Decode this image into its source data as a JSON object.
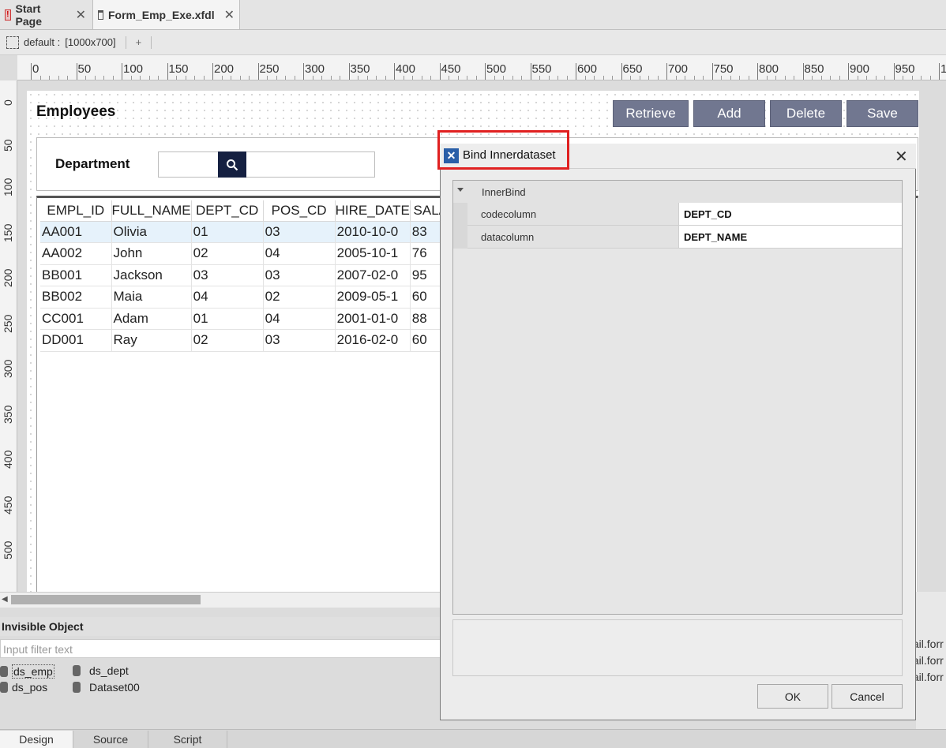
{
  "tabs": [
    {
      "label": "Start Page",
      "close": "✕"
    },
    {
      "label": "Form_Emp_Exe.xfdl",
      "close": "✕"
    }
  ],
  "toolbar": {
    "layout_label": "default :",
    "layout_size": "[1000x700]",
    "add": "+"
  },
  "ruler": {
    "h": [
      "0",
      "50",
      "100",
      "150",
      "200",
      "250",
      "300",
      "350",
      "400",
      "450",
      "500",
      "550",
      "600",
      "650",
      "700",
      "750",
      "800",
      "850",
      "900",
      "950",
      "1"
    ],
    "v": [
      "0",
      "50",
      "100",
      "150",
      "200",
      "250",
      "300",
      "350",
      "400",
      "450",
      "500"
    ]
  },
  "form": {
    "title": "Employees",
    "buttons": [
      "Retrieve",
      "Add",
      "Delete",
      "Save"
    ],
    "dept_label": "Department"
  },
  "grid": {
    "columns": [
      "EMPL_ID",
      "FULL_NAME",
      "DEPT_CD",
      "POS_CD",
      "HIRE_DATE",
      "SALA"
    ],
    "rows": [
      [
        "AA001",
        "Olivia",
        "01",
        "03",
        "2010-10-0",
        "83"
      ],
      [
        "AA002",
        "John",
        "02",
        "04",
        "2005-10-1",
        "76"
      ],
      [
        "BB001",
        "Jackson",
        "03",
        "03",
        "2007-02-0",
        "95"
      ],
      [
        "BB002",
        "Maia",
        "04",
        "02",
        "2009-05-1",
        "60"
      ],
      [
        "CC001",
        "Adam",
        "01",
        "04",
        "2001-01-0",
        "88"
      ],
      [
        "DD001",
        "Ray",
        "02",
        "03",
        "2016-02-0",
        "60"
      ]
    ]
  },
  "invisible": {
    "header": "Invisible Object",
    "filter_placeholder": "Input filter text",
    "items": [
      "ds_emp",
      "ds_dept",
      "ds_pos",
      "Dataset00"
    ]
  },
  "right_strip": [
    "tail.forr",
    "tail.forr",
    "tail.forr"
  ],
  "bottom_tabs": [
    "Design",
    "Source",
    "Script"
  ],
  "dialog": {
    "title": "Bind Innerdataset",
    "close": "✕",
    "group": "InnerBind",
    "props": [
      {
        "name": "codecolumn",
        "value": "DEPT_CD"
      },
      {
        "name": "datacolumn",
        "value": "DEPT_NAME"
      }
    ],
    "ok": "OK",
    "cancel": "Cancel"
  }
}
